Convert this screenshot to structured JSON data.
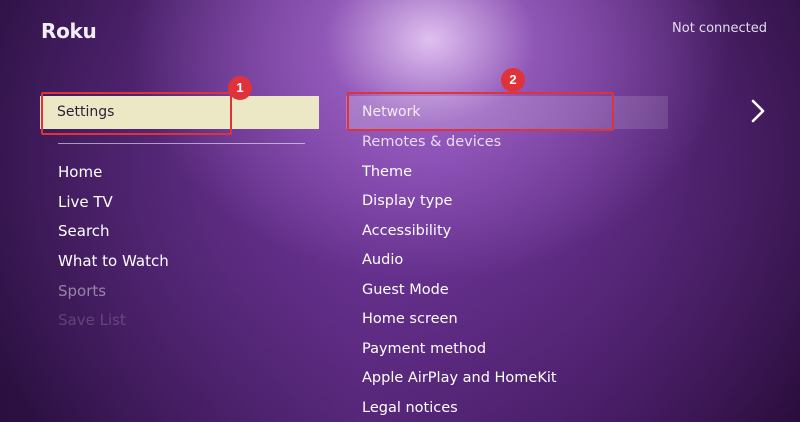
{
  "header": {
    "logo": "Roku",
    "status": "Not connected"
  },
  "left_menu": {
    "selected": "Settings",
    "items": [
      {
        "label": "Home",
        "state": "normal"
      },
      {
        "label": "Live TV",
        "state": "normal"
      },
      {
        "label": "Search",
        "state": "normal"
      },
      {
        "label": "What to Watch",
        "state": "normal"
      },
      {
        "label": "Sports",
        "state": "dim"
      },
      {
        "label": "Save List",
        "state": "faint"
      }
    ]
  },
  "right_menu": {
    "selected": "Network",
    "items": [
      {
        "label": "Remotes & devices"
      },
      {
        "label": "Theme"
      },
      {
        "label": "Display type"
      },
      {
        "label": "Accessibility"
      },
      {
        "label": "Audio"
      },
      {
        "label": "Guest Mode"
      },
      {
        "label": "Home screen"
      },
      {
        "label": "Payment method"
      },
      {
        "label": "Apple AirPlay and HomeKit"
      },
      {
        "label": "Legal notices"
      }
    ]
  },
  "icons": {
    "next": "chevron-right-icon"
  },
  "annotations": {
    "badge_1": "1",
    "badge_2": "2",
    "color": "#e0323b"
  },
  "colors": {
    "selected_bg": "#ece8c6",
    "selected_text": "#2b2238"
  }
}
